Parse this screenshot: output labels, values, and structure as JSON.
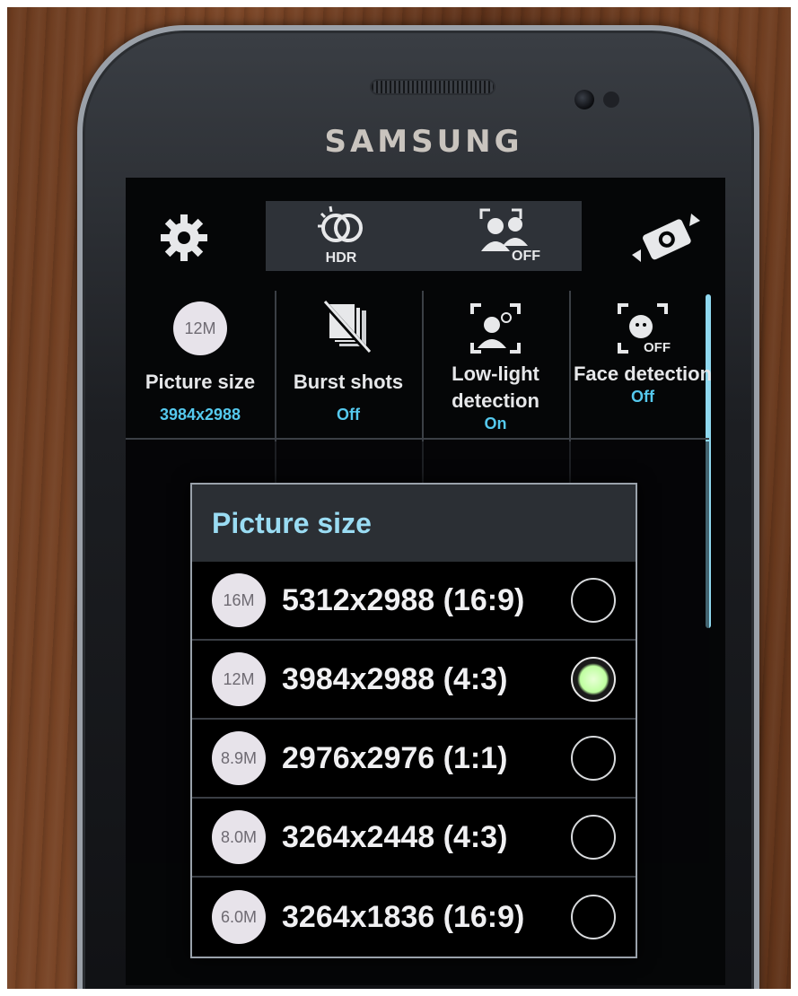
{
  "brand": "SAMSUNG",
  "toolbar": {
    "hdr_label": "HDR",
    "face_off_label": "OFF"
  },
  "settings": [
    {
      "label": "Picture size",
      "value": "3984x2988",
      "icon": "size-badge",
      "badge": "12M"
    },
    {
      "label": "Burst shots",
      "value": "Off",
      "icon": "burst-off-icon"
    },
    {
      "label": "Low-light detection",
      "value": "On",
      "icon": "low-light-icon"
    },
    {
      "label": "Face detection",
      "value": "Off",
      "icon": "face-detection-off-icon"
    }
  ],
  "dialog": {
    "title": "Picture size",
    "options": [
      {
        "badge": "16M",
        "label": "5312x2988 (16:9)",
        "selected": false
      },
      {
        "badge": "12M",
        "label": "3984x2988 (4:3)",
        "selected": true
      },
      {
        "badge": "8.9M",
        "label": "2976x2976 (1:1)",
        "selected": false
      },
      {
        "badge": "8.0M",
        "label": "3264x2448 (4:3)",
        "selected": false
      },
      {
        "badge": "6.0M",
        "label": "3264x1836 (16:9)",
        "selected": false
      }
    ]
  },
  "colors": {
    "accent_blue": "#55c9ee",
    "dialog_title": "#9adcf3",
    "radio_selected": "#bfffa0"
  }
}
